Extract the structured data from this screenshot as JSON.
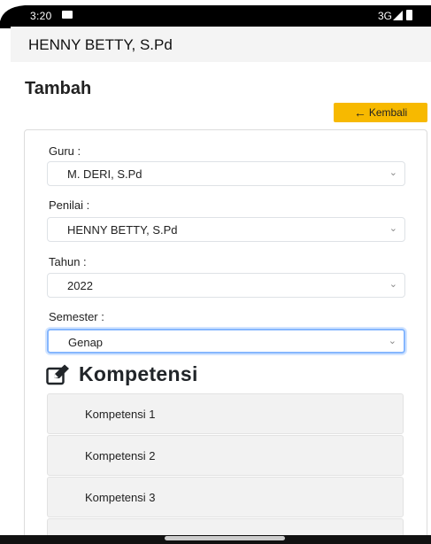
{
  "status_bar": {
    "time": "3:20",
    "network": "3G",
    "icons": [
      "sim-icon",
      "signal-icon",
      "battery-icon"
    ]
  },
  "app_bar": {
    "title": "HENNY BETTY, S.Pd"
  },
  "page": {
    "title": "Tambah"
  },
  "back_button": {
    "label": "Kembali",
    "icon": "arrow-left-icon",
    "color": "#f7b900"
  },
  "form": {
    "guru": {
      "label": "Guru :",
      "value": "M. DERI, S.Pd"
    },
    "penilai": {
      "label": "Penilai :",
      "value": "HENNY BETTY, S.Pd"
    },
    "tahun": {
      "label": "Tahun :",
      "value": "2022"
    },
    "semester": {
      "label": "Semester :",
      "value": "Genap"
    }
  },
  "kompetensi": {
    "title": "Kompetensi",
    "icon": "edit-icon",
    "items": [
      "Kompetensi 1",
      "Kompetensi 2",
      "Kompetensi 3",
      ""
    ]
  }
}
